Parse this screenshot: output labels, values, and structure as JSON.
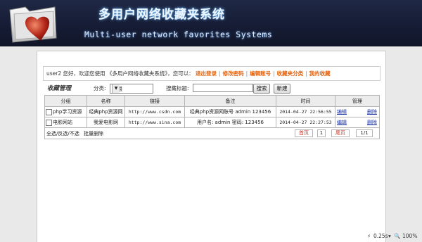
{
  "header": {
    "title_cn": "多用户网络收藏夹系统",
    "title_en": "Multi-user network favorites Systems"
  },
  "welcome": {
    "prefix": "user2 您好，欢迎您使用 《多用户网络收藏夹系统》，您可以：",
    "links": [
      "退出登录",
      "修改密码",
      "编辑账号",
      "收藏夹分类",
      "我的收藏"
    ],
    "separator": "|"
  },
  "toolbar": {
    "heading": "收藏管理",
    "category_label": "分类:",
    "category_value": "不限",
    "search_label": "搜藏标题:",
    "search_value": "",
    "search_button": "搜索",
    "new_button": "新建"
  },
  "table": {
    "columns": [
      "分组",
      "名称",
      "链接",
      "备注",
      "时间",
      "管理"
    ],
    "rows": [
      {
        "group": "php学习资源",
        "name": "经典php资源网",
        "url": "http://www.csdn.com",
        "note": "经典php资源网账号 admin 123456",
        "time": "2014-04-27 22:56:55",
        "edit": "编辑",
        "delete": "删除"
      },
      {
        "group": "电影网站",
        "name": "我爱电影网",
        "url": "http://www.sina.com",
        "note": "用户名: admin 密码: 123456",
        "time": "2014-04-27 22:27:53",
        "edit": "编辑",
        "delete": "删除"
      }
    ],
    "footer": {
      "select_text": "全选/反选/不选",
      "batch_delete": "批量删除",
      "first": "首页",
      "page": "1",
      "last": "尾页",
      "total": "1/1"
    }
  },
  "statusbar": {
    "timing": "0.25s",
    "zoom": "100%"
  },
  "colors": {
    "header_bg": "#161c35",
    "link_orange": "#e5620b",
    "action_blue": "#1a33a6"
  }
}
